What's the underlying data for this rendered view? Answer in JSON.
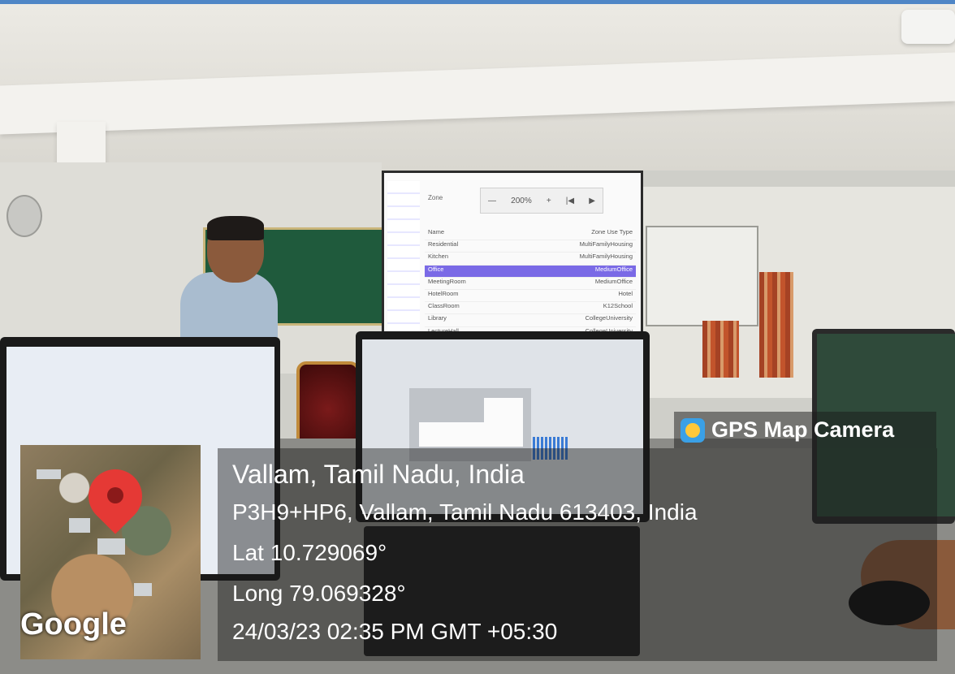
{
  "stamp_app": "GPS Map Camera",
  "place": "Vallam, Tamil Nadu, India",
  "address": "P3H9+HP6, Vallam, Tamil Nadu 613403, India",
  "latitude": "Lat 10.729069°",
  "longitude": "Long 79.069328°",
  "datetime": "24/03/23 02:35 PM GMT +05:30",
  "map_brand": "Google",
  "projection": {
    "field_label": "Zone",
    "zoom": "200%",
    "columns": [
      "Name",
      "Zone Use Type"
    ],
    "rows": [
      {
        "name": "Residential",
        "type": "MultiFamilyHousing"
      },
      {
        "name": "Kitchen",
        "type": "MultiFamilyHousing"
      },
      {
        "name": "Office",
        "type": "MediumOffice",
        "selected": true
      },
      {
        "name": "MeetingRoom",
        "type": "MediumOffice"
      },
      {
        "name": "HotelRoom",
        "type": "Hotel"
      },
      {
        "name": "ClassRoom",
        "type": "K12School"
      },
      {
        "name": "Library",
        "type": "CollegeUniversity"
      },
      {
        "name": "LectureHall",
        "type": "CollegeUniversity"
      }
    ]
  },
  "colors": {
    "pin": "#e53935",
    "overlay": "rgba(25,25,25,.45)",
    "board": "#1f5a3c"
  }
}
